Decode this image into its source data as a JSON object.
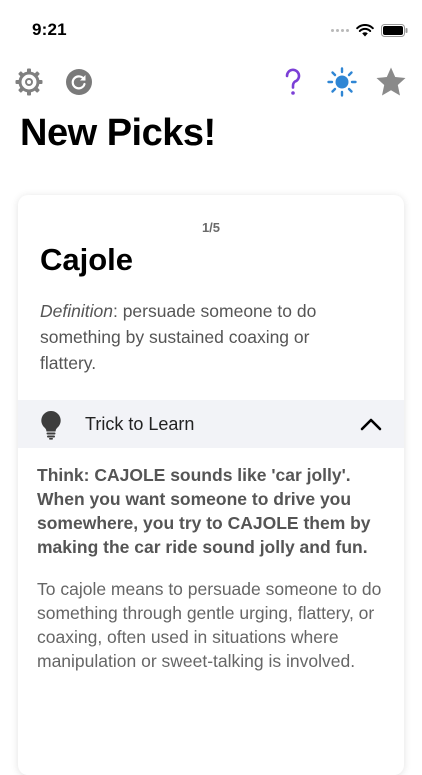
{
  "status_bar": {
    "time": "9:21"
  },
  "toolbar": {
    "left_icons": [
      "gear-icon",
      "refresh-icon"
    ],
    "right_icons": [
      "help-icon",
      "sun-icon",
      "star-icon"
    ],
    "help_color": "#7b3fd6",
    "sun_color": "#2f86d4",
    "star_color": "#8a8a8a"
  },
  "page": {
    "title": "New Picks!"
  },
  "card": {
    "counter": "1/5",
    "word": "Cajole",
    "definition_label": "Definition",
    "definition_text": ": persuade someone to do something by sustained coaxing or flattery.",
    "trick": {
      "label": "Trick to Learn",
      "expanded": true,
      "mnemonic": "Think: CAJOLE sounds like 'car jolly'. When you want someone to drive you somewhere, you try to CAJOLE them by making the car ride sound jolly and fun.",
      "explanation": "To cajole means to persuade someone to do something through gentle urging, flattery, or coaxing, often used in situations where manipulation or sweet-talking is involved."
    }
  }
}
